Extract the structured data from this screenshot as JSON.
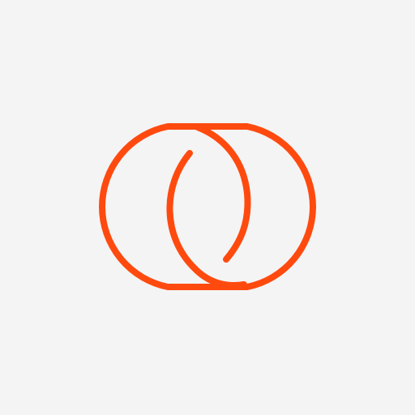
{
  "icon": {
    "name": "toggle-overlap-logo",
    "accent_color": "#ff4a0f",
    "background_color": "#f4f4f4"
  }
}
